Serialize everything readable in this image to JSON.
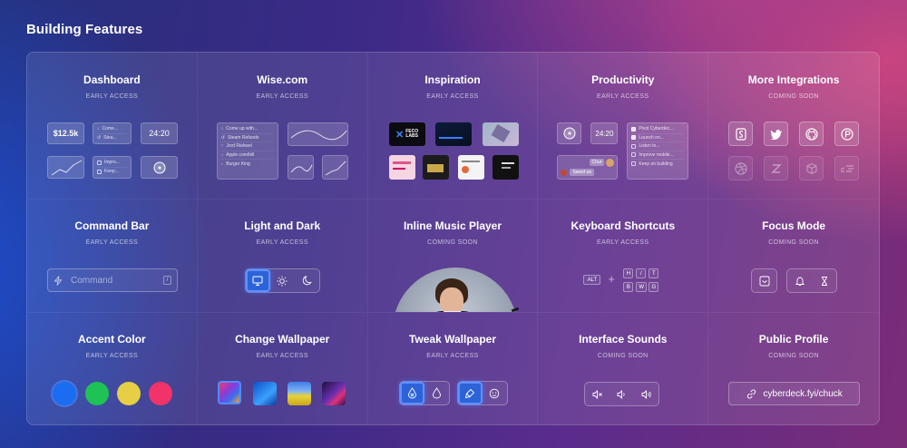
{
  "page": {
    "title": "Building Features"
  },
  "cards": [
    {
      "title": "Dashboard",
      "status": "EARLY ACCESS"
    },
    {
      "title": "Wise.com",
      "status": "EARLY ACCESS"
    },
    {
      "title": "Inspiration",
      "status": "EARLY ACCESS"
    },
    {
      "title": "Productivity",
      "status": "EARLY ACCESS"
    },
    {
      "title": "More Integrations",
      "status": "COMING SOON"
    },
    {
      "title": "Command Bar",
      "status": "EARLY ACCESS"
    },
    {
      "title": "Light and Dark",
      "status": "EARLY ACCESS"
    },
    {
      "title": "Inline Music Player",
      "status": "COMING SOON"
    },
    {
      "title": "Keyboard Shortcuts",
      "status": "EARLY ACCESS"
    },
    {
      "title": "Focus Mode",
      "status": "COMING SOON"
    },
    {
      "title": "Accent Color",
      "status": "EARLY ACCESS"
    },
    {
      "title": "Change Wallpaper",
      "status": "EARLY ACCESS"
    },
    {
      "title": "Tweak Wallpaper",
      "status": "EARLY ACCESS"
    },
    {
      "title": "Interface Sounds",
      "status": "COMING SOON"
    },
    {
      "title": "Public Profile",
      "status": "COMING SOON"
    }
  ],
  "dashboard": {
    "balance": "$12.5k",
    "clock": "24:20",
    "list": [
      "Come...",
      "Stea..."
    ],
    "todo": [
      "Impro...",
      "Keep..."
    ]
  },
  "wise": {
    "transactions": [
      "Come up with...",
      "Steam Refunds",
      "Jord Riekwel",
      "Apple.com/bill",
      "Burger King"
    ]
  },
  "inspiration": {
    "thumb_label": "FECO LABS"
  },
  "productivity": {
    "clock": "24:20",
    "chat_name": "Chur",
    "chat_msg": "Sweet as",
    "tasks": [
      "Pivot Cyberdec...",
      "Launch on...",
      "Listen to...",
      "Improve mobile...",
      "Keep on building"
    ],
    "tasks_done": [
      true,
      true,
      false,
      false,
      false
    ]
  },
  "command_bar": {
    "placeholder": "Command",
    "shortcut": "/"
  },
  "shortcuts": {
    "modifier": "ALT",
    "plus": "+",
    "keys": [
      "H",
      "/",
      "T",
      "B",
      "W",
      "G"
    ]
  },
  "accent_colors": [
    "#1a6cf0",
    "#1fc254",
    "#e6cf44",
    "#f2336a"
  ],
  "public_profile": {
    "url": "cyberdeck.fyi/chuck"
  },
  "colors": {
    "active_button": "#2d63d8"
  }
}
